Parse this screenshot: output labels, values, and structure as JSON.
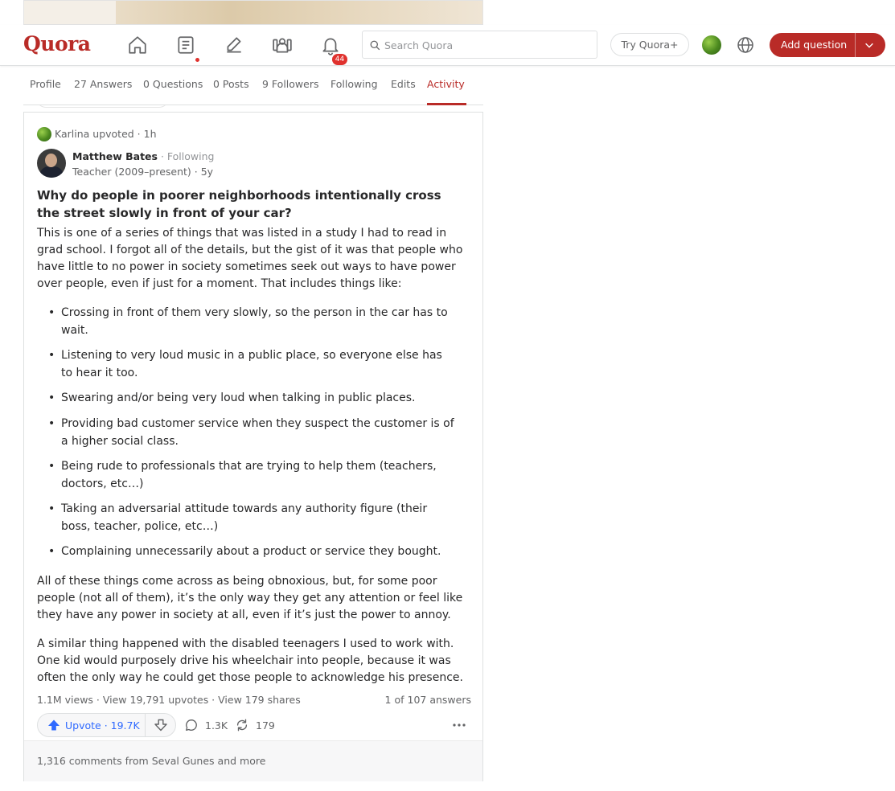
{
  "nav": {
    "logo": "Quora",
    "notification_count": "44",
    "search_placeholder": "Search Quora",
    "try_plus": "Try Quora+",
    "add_question": "Add question"
  },
  "tabs": [
    {
      "label": "Profile",
      "active": false
    },
    {
      "label": "27 Answers",
      "active": false
    },
    {
      "label": "0 Questions",
      "active": false
    },
    {
      "label": "0 Posts",
      "active": false
    },
    {
      "label": "9 Followers",
      "active": false
    },
    {
      "label": "Following",
      "active": false
    },
    {
      "label": "Edits",
      "active": false
    },
    {
      "label": "Activity",
      "active": true
    }
  ],
  "activity": {
    "actor_text": "Karlina upvoted · 1h"
  },
  "answer": {
    "author_name": "Matthew Bates",
    "follow_status": "Following",
    "credential": "Teacher (2009–present)",
    "age": "5y",
    "question": "Why do people in poorer neighborhoods intentionally cross the street slowly in front of your car?",
    "intro": "This is one of a series of things that was listed in a study I had to read in grad school. I forgot all of the details, but the gist of it was that people who have little to no power in society sometimes seek out ways to have power over people, even if just for a moment. That includes things like:",
    "bullets": [
      "Crossing in front of them very slowly, so the person in the car has to wait.",
      "Listening to very loud music in a public place, so everyone else has to hear it too.",
      "Swearing and/or being very loud when talking in public places.",
      "Providing bad customer service when they suspect the customer is of a higher social class.",
      "Being rude to professionals that are trying to help them (teachers, doctors, etc…)",
      "Taking an adversarial attitude towards any authority figure (their boss, teacher, police, etc…)",
      "Complaining unnecessarily about a product or service they bought."
    ],
    "para2": "All of these things come across as being obnoxious, but, for some poor people (not all of them), it’s the only way they get any attention or feel like they have any power in society at all, even if it’s just the power to annoy.",
    "para3": "A similar thing happened with the disabled teenagers I used to work with. One kid would purposely drive his wheelchair into people, because it was often the only way he could get those people to acknowledge his presence.",
    "stats_left": "1.1M views · View 19,791 upvotes · View 179 shares",
    "stats_right": "1 of 107 answers",
    "upvote_label": "Upvote · 19.7K",
    "comment_count": "1.3K",
    "share_count": "179",
    "comments_summary": "1,316 comments from Seval Gunes and more"
  },
  "colors": {
    "brand": "#b92b27",
    "upvote_blue": "#2e69ff",
    "badge_red": "#e0322e"
  }
}
